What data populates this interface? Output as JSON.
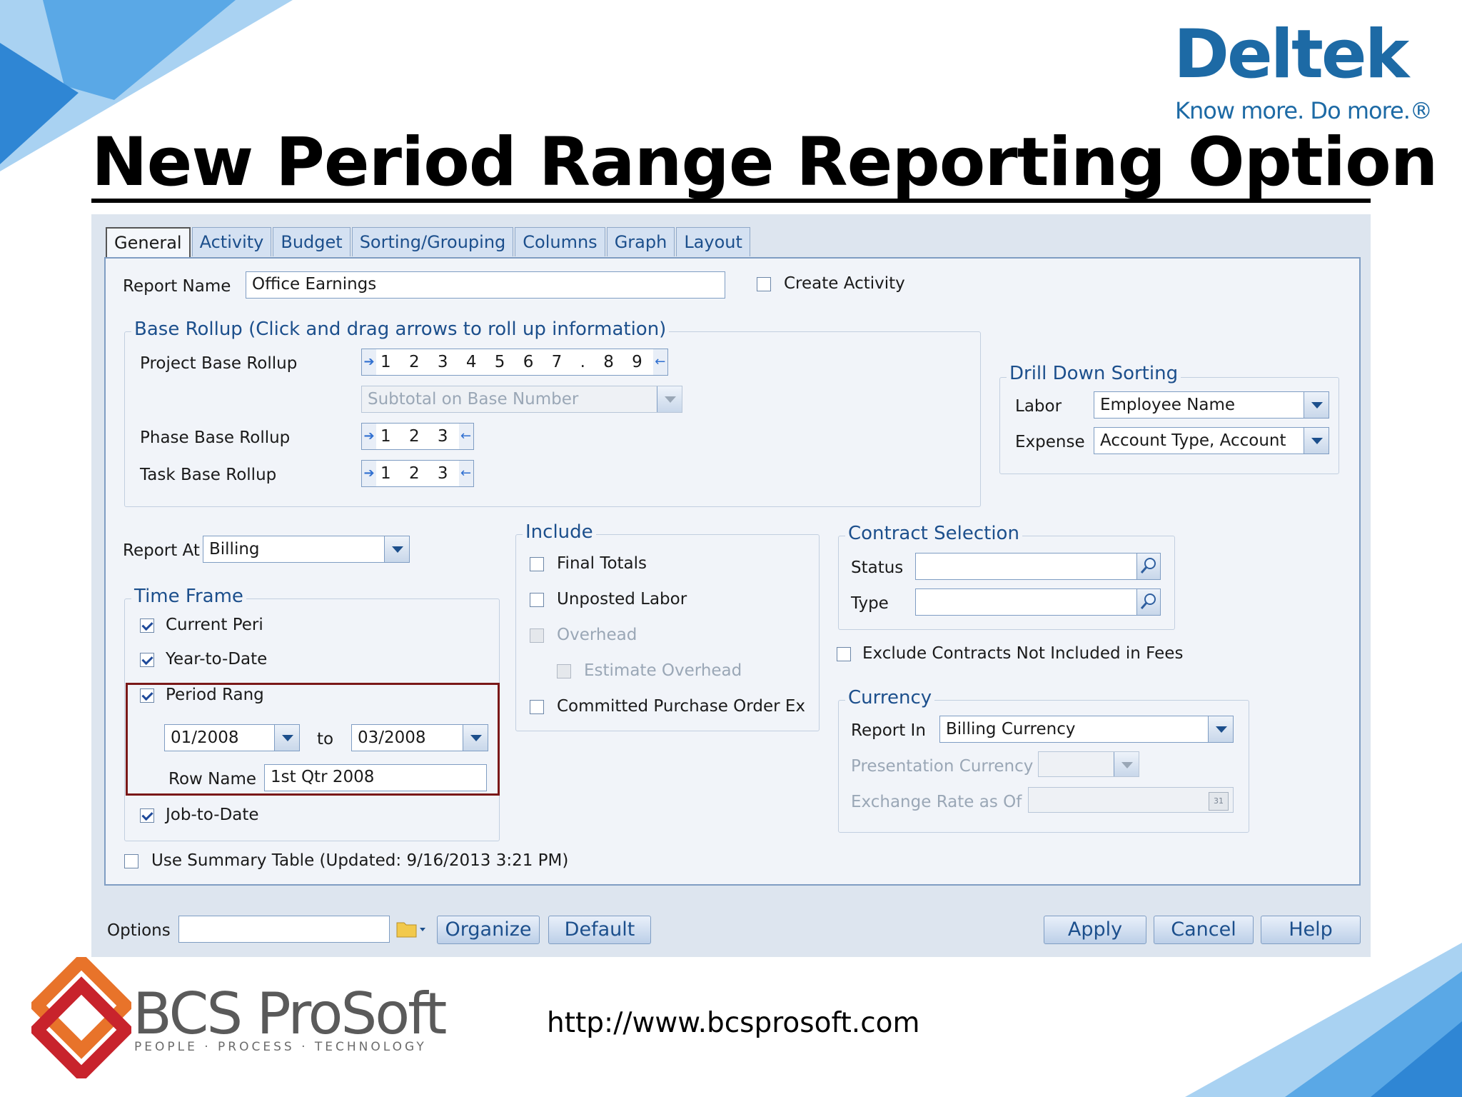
{
  "slide": {
    "title": "New Period Range Reporting Option",
    "url": "http://www.bcsprosoft.com"
  },
  "branding": {
    "deltek_name": "Deltek",
    "deltek_tagline": "Know more. Do more.®",
    "bcs_name": "BCS ProSoft",
    "bcs_tagline": "PEOPLE · PROCESS · TECHNOLOGY",
    "colors": {
      "deltek_blue": "#1d6aa5",
      "bcs_orange": "#e8732a",
      "bcs_red": "#c8232c",
      "highlight": "#7a1818"
    }
  },
  "tabs": [
    "General",
    "Activity",
    "Budget",
    "Sorting/Grouping",
    "Columns",
    "Graph",
    "Layout"
  ],
  "general": {
    "report_name_label": "Report Name",
    "report_name_value": "Office Earnings",
    "create_activity_label": "Create Activity",
    "base_rollup": {
      "legend": "Base Rollup (Click and drag arrows to roll up information)",
      "project_label": "Project Base Rollup",
      "project_digits": "1 2 3 4 5 6 7 . 8 9",
      "subtotal_value": "Subtotal on Base Number",
      "phase_label": "Phase Base Rollup",
      "phase_digits": "1 2 3",
      "task_label": "Task Base Rollup",
      "task_digits": "1 2 3"
    },
    "drill_down": {
      "legend": "Drill Down Sorting",
      "labor_label": "Labor",
      "labor_value": "Employee Name",
      "expense_label": "Expense",
      "expense_value": "Account Type, Account"
    },
    "report_at_label": "Report At",
    "report_at_value": "Billing",
    "time_frame": {
      "legend": "Time Frame",
      "current_period": "Current Peri",
      "ytd": "Year-to-Date",
      "period_range": "Period Rang",
      "from_value": "01/2008",
      "to_label": "to",
      "to_value": "03/2008",
      "row_name_label": "Row Name",
      "row_name_value": "1st Qtr 2008",
      "jtd": "Job-to-Date"
    },
    "include": {
      "legend": "Include",
      "final_totals": "Final Totals",
      "unposted_labor": "Unposted Labor",
      "overhead": "Overhead",
      "estimate_overhead": "Estimate Overhead",
      "committed_po": "Committed  Purchase  Order Ex"
    },
    "contract_selection": {
      "legend": "Contract Selection",
      "status_label": "Status",
      "type_label": "Type"
    },
    "exclude_contracts_label": "Exclude Contracts Not Included in Fees",
    "currency": {
      "legend": "Currency",
      "report_in_label": "Report In",
      "report_in_value": "Billing Currency",
      "presentation_label": "Presentation Currency",
      "exchange_label": "Exchange Rate as Of",
      "calendar_day": "31"
    },
    "summary_table_label": "Use Summary Table (Updated: 9/16/2013 3:21 PM)"
  },
  "bottom": {
    "options_label": "Options",
    "organize": "Organize",
    "default": "Default",
    "apply": "Apply",
    "cancel": "Cancel",
    "help": "Help"
  }
}
